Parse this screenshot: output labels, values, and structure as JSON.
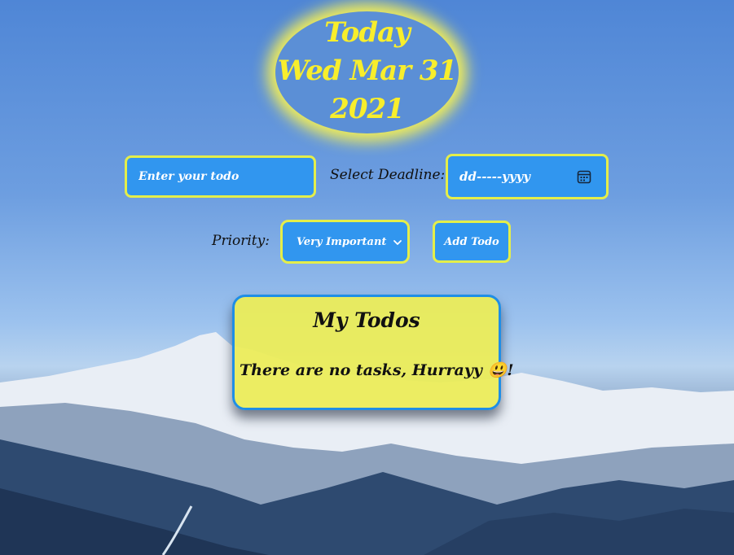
{
  "header": {
    "line1": "Today",
    "line2": "Wed Mar 31",
    "line3": "2021"
  },
  "form": {
    "todo_placeholder": "Enter your todo",
    "deadline_label": "Select Deadline:",
    "date_placeholder": "dd-----yyyy",
    "priority_label": "Priority:",
    "priority_selected": "Very Important",
    "add_label": "Add Todo"
  },
  "todos": {
    "title": "My Todos",
    "empty_message": "There are no tasks, Hurrayy 😃!"
  },
  "icons": {
    "calendar": "calendar-icon",
    "dropdown": "chevron-down-icon"
  },
  "colors": {
    "accent_blue": "#3196ef",
    "accent_yellow": "#e4ee4a",
    "title_yellow": "#f8ee2c",
    "card_yellow": "#ecec58"
  }
}
